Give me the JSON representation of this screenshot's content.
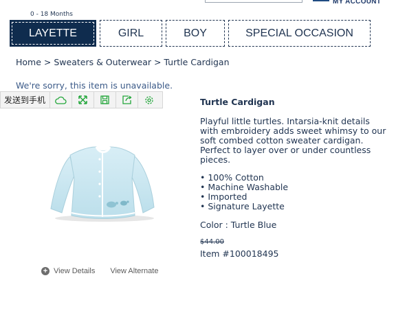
{
  "header": {
    "my_account": "MY ACCOUNT",
    "age_range": "0 - 18 Months"
  },
  "nav": {
    "tabs": [
      {
        "label": "LAYETTE",
        "active": true
      },
      {
        "label": "GIRL",
        "active": false
      },
      {
        "label": "BOY",
        "active": false
      },
      {
        "label": "SPECIAL OCCASION",
        "active": false
      }
    ]
  },
  "breadcrumb": {
    "items": [
      "Home",
      "Sweaters & Outerwear",
      "Turtle Cardigan"
    ],
    "separator": " > "
  },
  "notice": "We're sorry, this item is unavailable.",
  "share_toolbar": {
    "label": "发送到手机",
    "icons": [
      "cloud-icon",
      "expand-icon",
      "save-icon",
      "share-icon",
      "settings-icon"
    ],
    "accent": "#22a63a"
  },
  "image_links": {
    "view_details": "View Details",
    "view_alternate": "View Alternate"
  },
  "product": {
    "title": "Turtle Cardigan",
    "description": "Playful little turtles. Intarsia-knit details with embroidery adds sweet whimsy to our soft combed cotton sweater cardigan. Perfect to layer over or under countless pieces.",
    "features": [
      "100% Cotton",
      "Machine Washable",
      "Imported",
      "Signature Layette"
    ],
    "color_label": "Color : Turtle Blue",
    "old_price": "$44.00",
    "item_number": "Item #100018495"
  },
  "colors": {
    "navy": "#0f2c4e",
    "text": "#1f3350",
    "cardigan": "#cfe9f2"
  }
}
